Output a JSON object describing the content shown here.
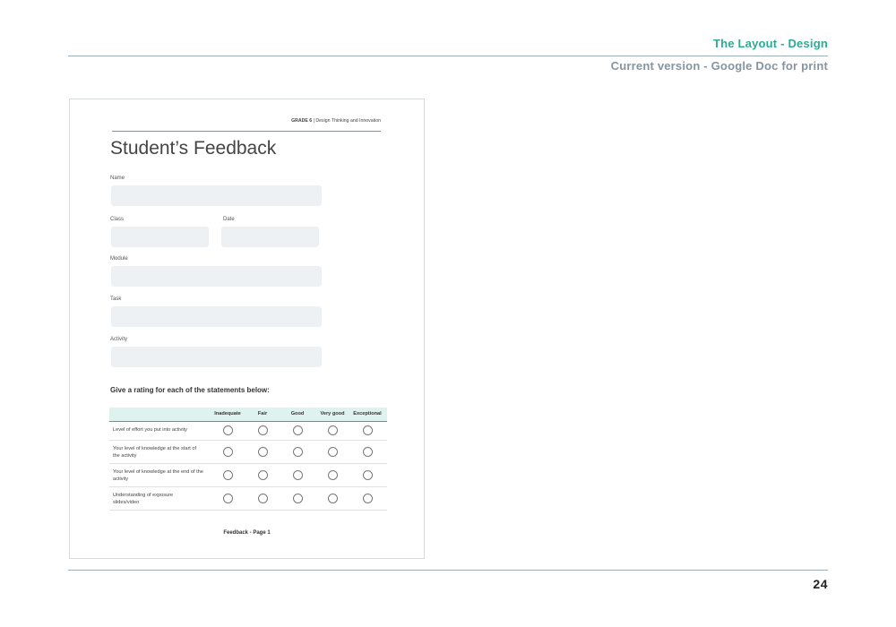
{
  "slide": {
    "title": "The Layout - Design",
    "subtitle": "Current version - Google Doc for print",
    "page_number": "24"
  },
  "doc": {
    "header_grade": "GRADE 6",
    "header_sep": "|",
    "header_subject": "Design Thinking and Innovation",
    "title": "Student’s Feedback",
    "fields": {
      "name": "Name",
      "class": "Class",
      "date": "Date",
      "module": "Module",
      "task": "Task",
      "activity": "Activity"
    },
    "instruction": "Give a rating for each of the statements below:",
    "rating_columns": [
      "Inadequate",
      "Fair",
      "Good",
      "Very good",
      "Exceptional"
    ],
    "statements": [
      "Level of effort you put into activity",
      "Your level of knowledge at the start of the activity",
      "Your level of knowledge at the end of the activity",
      "Understanding of exposure slides/video"
    ],
    "footer": "Feedback  -  Page 1"
  }
}
